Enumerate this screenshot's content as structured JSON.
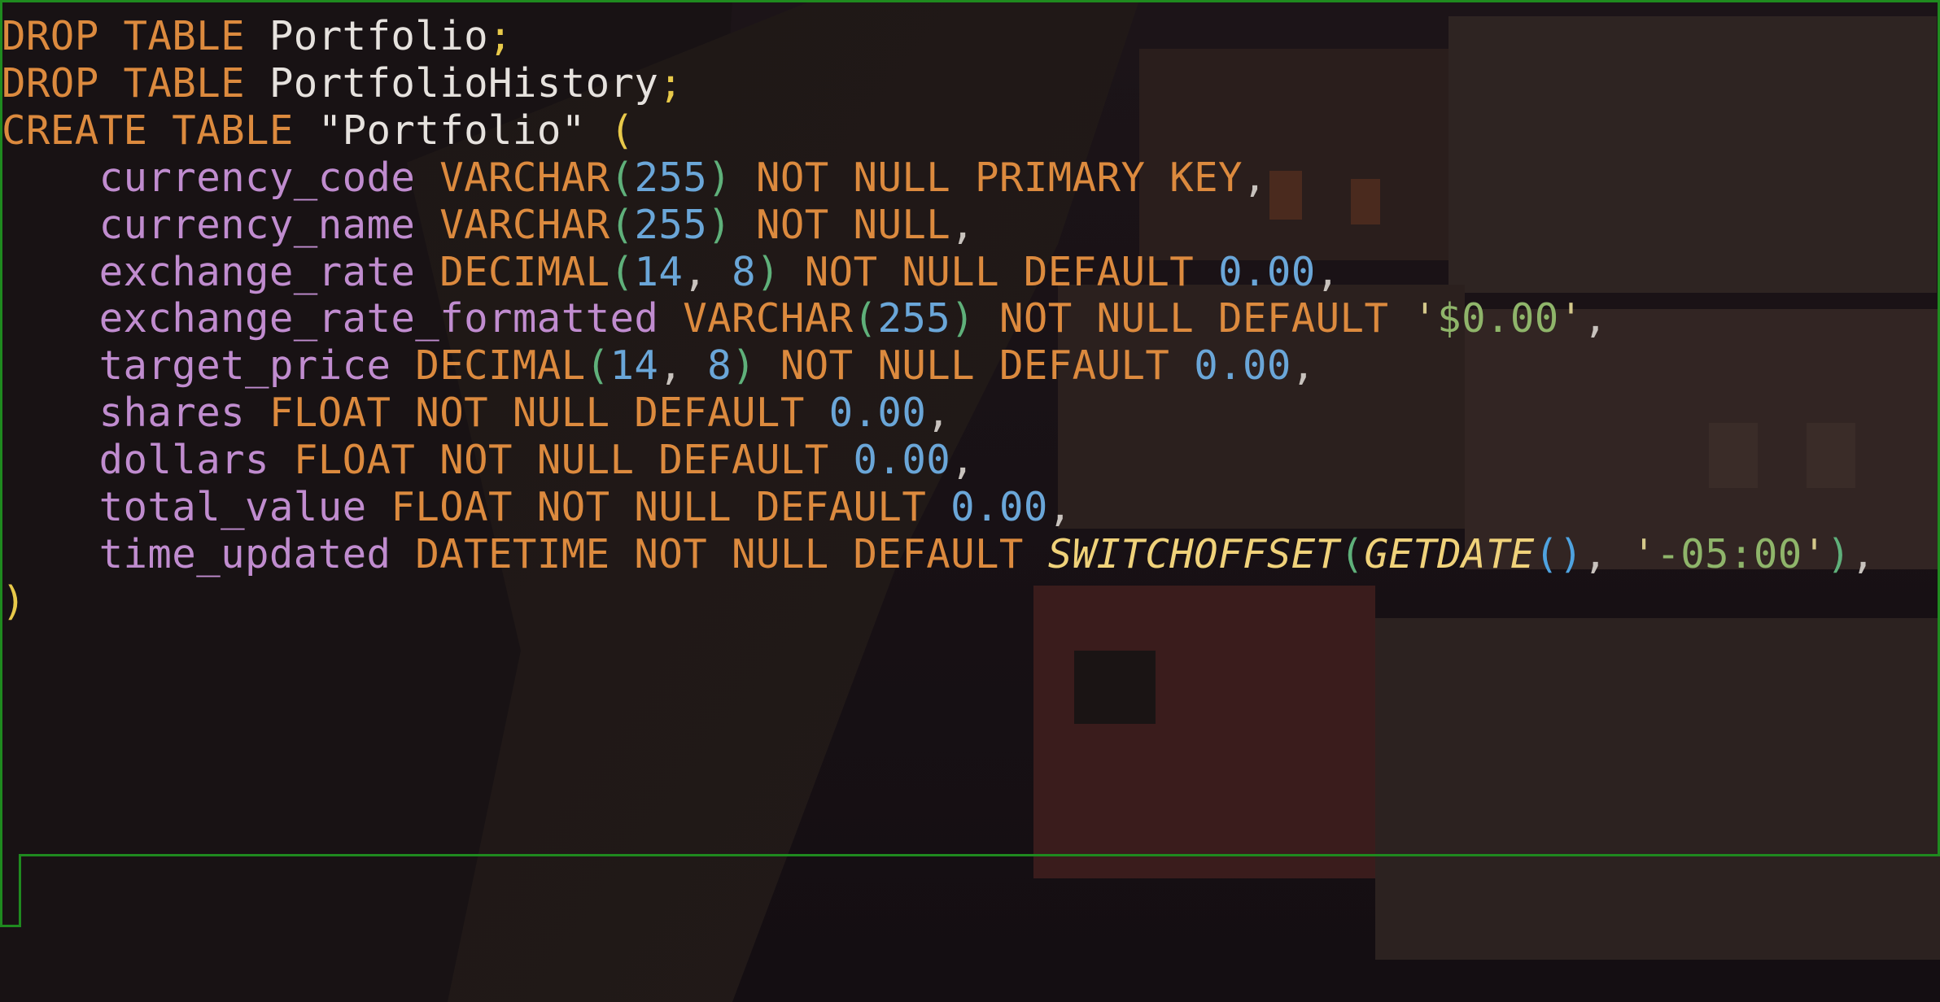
{
  "editor": {
    "language": "sql",
    "lines": [
      [
        {
          "t": "DROP TABLE ",
          "c": "kw"
        },
        {
          "t": "Portfolio",
          "c": "ident"
        },
        {
          "t": ";",
          "c": "semi"
        }
      ],
      [
        {
          "t": "DROP TABLE ",
          "c": "kw"
        },
        {
          "t": "PortfolioHistory",
          "c": "ident"
        },
        {
          "t": ";",
          "c": "semi"
        }
      ],
      [
        {
          "t": "CREATE TABLE ",
          "c": "kw"
        },
        {
          "t": "\"Portfolio\" ",
          "c": "ident"
        },
        {
          "t": "(",
          "c": "paren2"
        }
      ],
      [
        {
          "t": "    currency_code ",
          "c": "col"
        },
        {
          "t": "VARCHAR",
          "c": "kw"
        },
        {
          "t": "(",
          "c": "paren"
        },
        {
          "t": "255",
          "c": "num"
        },
        {
          "t": ")",
          "c": "paren"
        },
        {
          "t": " NOT NULL PRIMARY KEY",
          "c": "kw"
        },
        {
          "t": ",",
          "c": "punct"
        }
      ],
      [
        {
          "t": "    currency_name ",
          "c": "col"
        },
        {
          "t": "VARCHAR",
          "c": "kw"
        },
        {
          "t": "(",
          "c": "paren"
        },
        {
          "t": "255",
          "c": "num"
        },
        {
          "t": ")",
          "c": "paren"
        },
        {
          "t": " NOT NULL",
          "c": "kw"
        },
        {
          "t": ",",
          "c": "punct"
        }
      ],
      [
        {
          "t": "    exchange_rate ",
          "c": "col"
        },
        {
          "t": "DECIMAL",
          "c": "kw"
        },
        {
          "t": "(",
          "c": "paren"
        },
        {
          "t": "14",
          "c": "num"
        },
        {
          "t": ", ",
          "c": "punct"
        },
        {
          "t": "8",
          "c": "num"
        },
        {
          "t": ")",
          "c": "paren"
        },
        {
          "t": " NOT NULL DEFAULT ",
          "c": "kw"
        },
        {
          "t": "0.00",
          "c": "num"
        },
        {
          "t": ",",
          "c": "punct"
        }
      ],
      [
        {
          "t": "    exchange_rate_formatted ",
          "c": "col"
        },
        {
          "t": "VARCHAR",
          "c": "kw"
        },
        {
          "t": "(",
          "c": "paren"
        },
        {
          "t": "255",
          "c": "num"
        },
        {
          "t": ")",
          "c": "paren"
        },
        {
          "t": " NOT NULL DEFAULT ",
          "c": "kw"
        },
        {
          "t": "'",
          "c": "str-q"
        },
        {
          "t": "$0.00",
          "c": "str"
        },
        {
          "t": "'",
          "c": "str-q"
        },
        {
          "t": ",",
          "c": "punct"
        }
      ],
      [
        {
          "t": "    target_price ",
          "c": "col"
        },
        {
          "t": "DECIMAL",
          "c": "kw"
        },
        {
          "t": "(",
          "c": "paren"
        },
        {
          "t": "14",
          "c": "num"
        },
        {
          "t": ", ",
          "c": "punct"
        },
        {
          "t": "8",
          "c": "num"
        },
        {
          "t": ")",
          "c": "paren"
        },
        {
          "t": " NOT NULL DEFAULT ",
          "c": "kw"
        },
        {
          "t": "0.00",
          "c": "num"
        },
        {
          "t": ",",
          "c": "punct"
        }
      ],
      [
        {
          "t": "    shares ",
          "c": "col"
        },
        {
          "t": "FLOAT NOT NULL DEFAULT ",
          "c": "kw"
        },
        {
          "t": "0.00",
          "c": "num"
        },
        {
          "t": ",",
          "c": "punct"
        }
      ],
      [
        {
          "t": "    dollars ",
          "c": "col"
        },
        {
          "t": "FLOAT NOT NULL DEFAULT ",
          "c": "kw"
        },
        {
          "t": "0.00",
          "c": "num"
        },
        {
          "t": ",",
          "c": "punct"
        }
      ],
      [
        {
          "t": "    total_value ",
          "c": "col"
        },
        {
          "t": "FLOAT NOT NULL DEFAULT ",
          "c": "kw"
        },
        {
          "t": "0.00",
          "c": "num"
        },
        {
          "t": ",",
          "c": "punct"
        }
      ],
      [
        {
          "t": "    time_updated ",
          "c": "col"
        },
        {
          "t": "DATETIME NOT NULL DEFAULT ",
          "c": "kw"
        },
        {
          "t": "SWITCHOFFSET",
          "c": "fn"
        },
        {
          "t": "(",
          "c": "paren"
        },
        {
          "t": "GETDATE",
          "c": "fn"
        },
        {
          "t": "()",
          "c": "paren3"
        },
        {
          "t": ", ",
          "c": "punct"
        },
        {
          "t": "'",
          "c": "str-q"
        },
        {
          "t": "-05:00",
          "c": "str"
        },
        {
          "t": "'",
          "c": "str-q"
        },
        {
          "t": ")",
          "c": "paren"
        },
        {
          "t": ",",
          "c": "punct"
        }
      ],
      [
        {
          "t": ")",
          "c": "paren2"
        }
      ]
    ]
  },
  "colors": {
    "keyword": "#dc8a3e",
    "identifier": "#e6e2de",
    "column": "#c08ccf",
    "number": "#6aa6d8",
    "string": "#8fb56a",
    "function": "#f0d27a",
    "selection_border": "#1f8a1f",
    "background": "#1a1316"
  }
}
